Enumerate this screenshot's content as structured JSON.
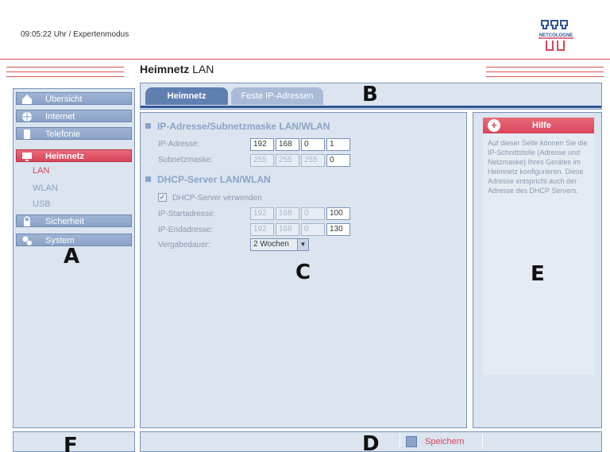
{
  "header": {
    "status": "09:05:22 Uhr  / Expertenmodus",
    "logo_text": "NETCOLOGNE"
  },
  "page": {
    "title_bold": "Heimnetz",
    "title_rest": " LAN"
  },
  "nav": {
    "items": [
      {
        "label": "Übersicht",
        "icon": "home-icon"
      },
      {
        "label": "Internet",
        "icon": "globe-icon"
      },
      {
        "label": "Telefonie",
        "icon": "phone-icon"
      },
      {
        "label": "Heimnetz",
        "icon": "network-icon",
        "active": true
      },
      {
        "label": "Sicherheit",
        "icon": "lock-icon"
      },
      {
        "label": "System",
        "icon": "gears-icon"
      }
    ],
    "subitems": [
      {
        "label": "LAN",
        "active": true
      },
      {
        "label": "WLAN"
      },
      {
        "label": "USB"
      }
    ]
  },
  "tabs": [
    {
      "label": "Heimnetz",
      "active": true
    },
    {
      "label": "Feste IP-Adressen"
    }
  ],
  "main": {
    "section1": {
      "title": "IP-Adresse/Subnetzmaske LAN/WLAN",
      "ip_label": "IP-Adresse:",
      "ip": [
        "192",
        "168",
        "0",
        "1"
      ],
      "mask_label": "Subnetzmaske:",
      "mask": [
        "255",
        "255",
        "255",
        "0"
      ]
    },
    "section2": {
      "title": "DHCP-Server LAN/WLAN",
      "dhcp_checkbox_label": "DHCP-Server verwenden",
      "dhcp_checked": "✓",
      "start_label": "IP-Startadresse:",
      "start": [
        "192",
        "168",
        "0",
        "100"
      ],
      "end_label": "IP-Endadresse:",
      "end": [
        "192",
        "168",
        "0",
        "130"
      ],
      "lease_label": "Vergabedauer:",
      "lease_value": "2 Wochen"
    }
  },
  "help": {
    "title": "Hilfe",
    "text": "Auf dieser Seite können Sie die IP-Schnittstelle (Adresse und Netzmaske) Ihres Gerätes im Heimnetz konfigurieren. Diese Adresse entspricht auch der Adresse des DHCP Servers."
  },
  "footer": {
    "save_label": "Speichern"
  },
  "annotations": {
    "A": "A",
    "B": "B",
    "C": "C",
    "D": "D",
    "E": "E",
    "F": "F"
  },
  "colors": {
    "accent": "#d9455a",
    "nav_blue": "#8aa3c8",
    "panel_bg": "#dbe4ef",
    "tab_active": "#5f7fb0"
  }
}
